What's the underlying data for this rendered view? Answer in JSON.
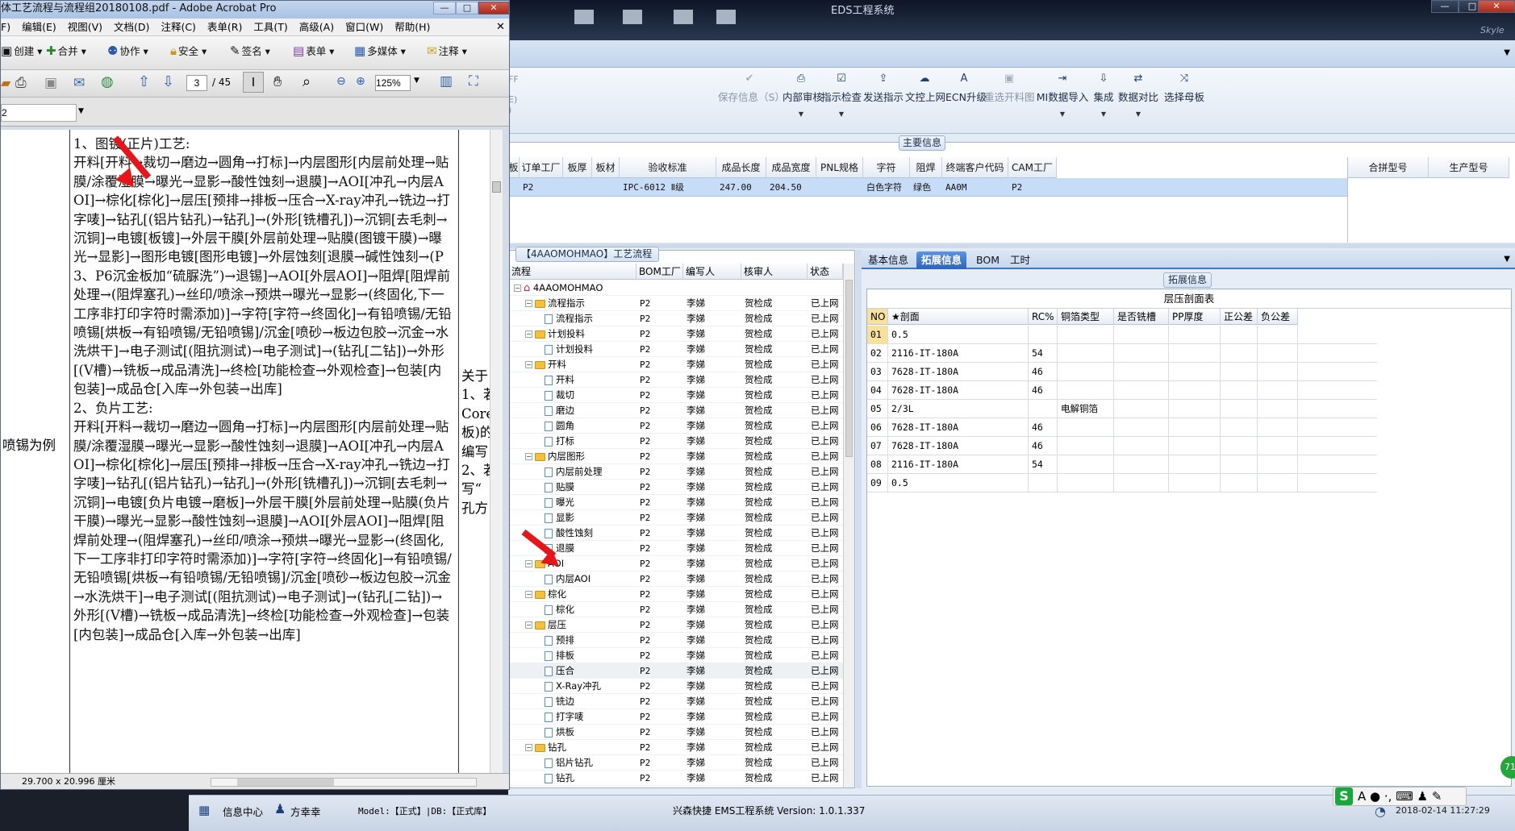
{
  "eds": {
    "title": "EDS工程系统",
    "skin": "Skyle",
    "window_buttons": [
      "—",
      "□",
      "✕"
    ],
    "toolbar": [
      {
        "label": "保存信息（S）",
        "icon": "checkmark-icon",
        "glyph": "✔",
        "disabled": true,
        "dropdown": false
      },
      {
        "label": "内部审核",
        "icon": "printer-icon",
        "glyph": "⎙",
        "disabled": false,
        "dropdown": true
      },
      {
        "label": "指示检查",
        "icon": "check-box-icon",
        "glyph": "☑",
        "disabled": false,
        "dropdown": true
      },
      {
        "label": "发送指示",
        "icon": "upload-icon",
        "glyph": "⇪",
        "disabled": false,
        "dropdown": false
      },
      {
        "label": "文控上网",
        "icon": "cloud-upload-icon",
        "glyph": "☁",
        "disabled": false,
        "dropdown": false
      },
      {
        "label": "ECN升级",
        "icon": "font-icon",
        "glyph": "A",
        "disabled": false,
        "dropdown": false
      },
      {
        "label": "重选开料图",
        "icon": "image-icon",
        "glyph": "▣",
        "disabled": true,
        "dropdown": false
      },
      {
        "label": "MI数据导入",
        "icon": "import-icon",
        "glyph": "⇥",
        "disabled": false,
        "dropdown": true
      },
      {
        "label": "集成",
        "icon": "download-icon",
        "glyph": "⇩",
        "disabled": false,
        "dropdown": true
      },
      {
        "label": "数据对比",
        "icon": "compare-icon",
        "glyph": "⇄",
        "disabled": false,
        "dropdown": true
      },
      {
        "label": "选择母板",
        "icon": "shuffle-icon",
        "glyph": "⤨",
        "disabled": false,
        "dropdown": false
      }
    ],
    "toolbar_left_stub": [
      "FF",
      "E)",
      ")"
    ],
    "main_info_title": "主要信息",
    "main_columns": [
      "板",
      "订单工厂",
      "板厚",
      "板材",
      "验收标准",
      "成品长度",
      "成品宽度",
      "PNL规格",
      "字符",
      "阻焊",
      "终端客户代码",
      "CAM工厂"
    ],
    "main_row": [
      "",
      "P2",
      "",
      "",
      "IPC-6012 Ⅱ级",
      "247.00",
      "204.50",
      "",
      "白色字符",
      "绿色",
      "AA0M",
      "P2"
    ],
    "right_columns": [
      "合拼型号",
      "生产型号"
    ],
    "flow_title": "【4AAOMOHMAO】工艺流程",
    "flow_columns": [
      "流程",
      "BOM工厂",
      "编写人",
      "核审人",
      "状态"
    ],
    "flow_root": "4AAOMOHMAO",
    "flow_rows": [
      {
        "name": "流程指示",
        "level": 1,
        "type": "folder",
        "bom": "P2",
        "writer": "李娣",
        "reviewer": "贺检成",
        "status": "已上网"
      },
      {
        "name": "流程指示",
        "level": 2,
        "type": "doc",
        "bom": "P2",
        "writer": "李娣",
        "reviewer": "贺检成",
        "status": "已上网"
      },
      {
        "name": "计划投料",
        "level": 1,
        "type": "folder",
        "bom": "P2",
        "writer": "李娣",
        "reviewer": "贺检成",
        "status": "已上网"
      },
      {
        "name": "计划投料",
        "level": 2,
        "type": "doc",
        "bom": "P2",
        "writer": "李娣",
        "reviewer": "贺检成",
        "status": "已上网"
      },
      {
        "name": "开料",
        "level": 1,
        "type": "folder",
        "bom": "P2",
        "writer": "李娣",
        "reviewer": "贺检成",
        "status": "已上网"
      },
      {
        "name": "开料",
        "level": 2,
        "type": "doc",
        "bom": "P2",
        "writer": "李娣",
        "reviewer": "贺检成",
        "status": "已上网"
      },
      {
        "name": "裁切",
        "level": 2,
        "type": "doc",
        "bom": "P2",
        "writer": "李娣",
        "reviewer": "贺检成",
        "status": "已上网"
      },
      {
        "name": "磨边",
        "level": 2,
        "type": "doc",
        "bom": "P2",
        "writer": "李娣",
        "reviewer": "贺检成",
        "status": "已上网"
      },
      {
        "name": "圆角",
        "level": 2,
        "type": "doc",
        "bom": "P2",
        "writer": "李娣",
        "reviewer": "贺检成",
        "status": "已上网"
      },
      {
        "name": "打标",
        "level": 2,
        "type": "doc",
        "bom": "P2",
        "writer": "李娣",
        "reviewer": "贺检成",
        "status": "已上网"
      },
      {
        "name": "内层图形",
        "level": 1,
        "type": "folder",
        "bom": "P2",
        "writer": "李娣",
        "reviewer": "贺检成",
        "status": "已上网"
      },
      {
        "name": "内层前处理",
        "level": 2,
        "type": "doc",
        "bom": "P2",
        "writer": "李娣",
        "reviewer": "贺检成",
        "status": "已上网"
      },
      {
        "name": "贴膜",
        "level": 2,
        "type": "doc",
        "bom": "P2",
        "writer": "李娣",
        "reviewer": "贺检成",
        "status": "已上网"
      },
      {
        "name": "曝光",
        "level": 2,
        "type": "doc",
        "bom": "P2",
        "writer": "李娣",
        "reviewer": "贺检成",
        "status": "已上网"
      },
      {
        "name": "显影",
        "level": 2,
        "type": "doc",
        "bom": "P2",
        "writer": "李娣",
        "reviewer": "贺检成",
        "status": "已上网"
      },
      {
        "name": "酸性蚀刻",
        "level": 2,
        "type": "doc",
        "bom": "P2",
        "writer": "李娣",
        "reviewer": "贺检成",
        "status": "已上网"
      },
      {
        "name": "退膜",
        "level": 2,
        "type": "doc",
        "bom": "P2",
        "writer": "李娣",
        "reviewer": "贺检成",
        "status": "已上网"
      },
      {
        "name": "AOI",
        "level": 1,
        "type": "folder",
        "bom": "P2",
        "writer": "李娣",
        "reviewer": "贺检成",
        "status": "已上网"
      },
      {
        "name": "内层AOI",
        "level": 2,
        "type": "doc",
        "bom": "P2",
        "writer": "李娣",
        "reviewer": "贺检成",
        "status": "已上网"
      },
      {
        "name": "棕化",
        "level": 1,
        "type": "folder",
        "bom": "P2",
        "writer": "李娣",
        "reviewer": "贺检成",
        "status": "已上网"
      },
      {
        "name": "棕化",
        "level": 2,
        "type": "doc",
        "bom": "P2",
        "writer": "李娣",
        "reviewer": "贺检成",
        "status": "已上网"
      },
      {
        "name": "层压",
        "level": 1,
        "type": "folder",
        "bom": "P2",
        "writer": "李娣",
        "reviewer": "贺检成",
        "status": "已上网"
      },
      {
        "name": "预排",
        "level": 2,
        "type": "doc",
        "bom": "P2",
        "writer": "李娣",
        "reviewer": "贺检成",
        "status": "已上网"
      },
      {
        "name": "排板",
        "level": 2,
        "type": "doc",
        "bom": "P2",
        "writer": "李娣",
        "reviewer": "贺检成",
        "status": "已上网"
      },
      {
        "name": "压合",
        "level": 2,
        "type": "doc",
        "bom": "P2",
        "writer": "李娣",
        "reviewer": "贺检成",
        "status": "已上网",
        "selected": true
      },
      {
        "name": "X-Ray冲孔",
        "level": 2,
        "type": "doc",
        "bom": "P2",
        "writer": "李娣",
        "reviewer": "贺检成",
        "status": "已上网"
      },
      {
        "name": "铣边",
        "level": 2,
        "type": "doc",
        "bom": "P2",
        "writer": "李娣",
        "reviewer": "贺检成",
        "status": "已上网"
      },
      {
        "name": "打字唛",
        "level": 2,
        "type": "doc",
        "bom": "P2",
        "writer": "李娣",
        "reviewer": "贺检成",
        "status": "已上网"
      },
      {
        "name": "烘板",
        "level": 2,
        "type": "doc",
        "bom": "P2",
        "writer": "李娣",
        "reviewer": "贺检成",
        "status": "已上网"
      },
      {
        "name": "钻孔",
        "level": 1,
        "type": "folder",
        "bom": "P2",
        "writer": "李娣",
        "reviewer": "贺检成",
        "status": "已上网"
      },
      {
        "name": "铝片钻孔",
        "level": 2,
        "type": "doc",
        "bom": "P2",
        "writer": "李娣",
        "reviewer": "贺检成",
        "status": "已上网"
      },
      {
        "name": "钻孔",
        "level": 2,
        "type": "doc",
        "bom": "P2",
        "writer": "李娣",
        "reviewer": "贺检成",
        "status": "已上网"
      }
    ],
    "detail_tabs": [
      "基本信息",
      "拓展信息",
      "BOM",
      "工时"
    ],
    "detail_active_tab": 1,
    "ext_title": "拓展信息",
    "stack_title": "层压剖面表",
    "stack_columns": [
      "NO",
      "★剖面",
      "RC%",
      "铜箔类型",
      "是否铣槽",
      "PP厚度",
      "正公差",
      "负公差"
    ],
    "stack_rows": [
      [
        "01",
        "0.5",
        "",
        "",
        "",
        "",
        "",
        ""
      ],
      [
        "02",
        "2116-IT-180A",
        "54",
        "",
        "",
        "",
        "",
        ""
      ],
      [
        "03",
        "7628-IT-180A",
        "46",
        "",
        "",
        "",
        "",
        ""
      ],
      [
        "04",
        "7628-IT-180A",
        "46",
        "",
        "",
        "",
        "",
        ""
      ],
      [
        "05",
        "2/3L",
        "",
        "电解铜箔",
        "",
        "",
        "",
        ""
      ],
      [
        "06",
        "7628-IT-180A",
        "46",
        "",
        "",
        "",
        "",
        ""
      ],
      [
        "07",
        "7628-IT-180A",
        "46",
        "",
        "",
        "",
        "",
        ""
      ],
      [
        "08",
        "2116-IT-180A",
        "54",
        "",
        "",
        "",
        "",
        ""
      ],
      [
        "09",
        "0.5",
        "",
        "",
        "",
        "",
        "",
        ""
      ]
    ]
  },
  "statusbar": {
    "info_center": "信息中心",
    "user": "方幸幸",
    "model": "Model:【正式】|DB:【正式库】",
    "system": "兴森快捷  EMS工程系统  Version: 1.0.1.337",
    "datetime": "2018-02-14  11:27:29",
    "tray_badge": "71",
    "ime": "S"
  },
  "acrobat": {
    "title": "体工艺流程与流程组20180108.pdf - Adobe Acrobat Pro",
    "menus": [
      "F)",
      "编辑(E)",
      "视图(V)",
      "文档(D)",
      "注释(C)",
      "表单(R)",
      "工具(T)",
      "高级(A)",
      "窗口(W)",
      "帮助(H)"
    ],
    "toolbar1": [
      "创建",
      "合并",
      "协作",
      "安全",
      "签名",
      "表单",
      "多媒体",
      "注释"
    ],
    "page_current": "3",
    "page_total": "/ 45",
    "zoom": "125%",
    "nav_value": "2",
    "page_size": "29.700 x 20.996 厘米",
    "left_cell_text": "喷锡为例",
    "right_cell_text": "关于\n1、若\nCore\n板)的\n编写\n2、若\n写“\n孔方",
    "body_text": "1、图镀(正片)工艺:\n开料[开料→裁切→磨边→圆角→打标]→内层图形[内层前处理→贴膜/涂覆湿膜→曝光→显影→酸性蚀刻→退膜]→AOI[冲孔→内层AOI]→棕化[棕化]→层压[预排→排板→压合→X-ray冲孔→铣边→打字唛]→钻孔[(铝片钻孔)→钻孔]→(外形[铣槽孔])→沉铜[去毛刺→沉铜]→电镀[板镀]→外层干膜[外层前处理→贴膜(图镀干膜)→曝光→显影]→图形电镀[图形电镀]→外层蚀刻[退膜→碱性蚀刻→(P3、P6沉金板加“硫脲洗”)→退锡]→AOI[外层AOI]→阻焊[阻焊前处理→(阻焊塞孔)→丝印/喷涂→预烘→曝光→显影→(终固化,下一工序非打印字符时需添加)]→字符[字符→终固化]→有铅喷锡/无铅喷锡[烘板→有铅喷锡/无铅喷锡]/沉金[喷砂→板边包胶→沉金→水洗烘干]→电子测试[(阻抗测试)→电子测试]→(钻孔[二钻])→外形[(V槽)→铣板→成品清洗]→终检[功能检查→外观检查]→包装[内包装]→成品仓[入库→外包装→出库]\n2、负片工艺:\n开料[开料→裁切→磨边→圆角→打标]→内层图形[内层前处理→贴膜/涂覆湿膜→曝光→显影→酸性蚀刻→退膜]→AOI[冲孔→内层AOI]→棕化[棕化]→层压[预排→排板→压合→X-ray冲孔→铣边→打字唛]→钻孔[(铝片钻孔)→钻孔]→(外形[铣槽孔])→沉铜[去毛刺→沉铜]→电镀[负片电镀→磨板]→外层干膜[外层前处理→贴膜(负片干膜)→曝光→显影→酸性蚀刻→退膜]→AOI[外层AOI]→阻焊[阻焊前处理→(阻焊塞孔)→丝印/喷涂→预烘→曝光→显影→(终固化,下一工序非打印字符时需添加)]→字符[字符→终固化]→有铅喷锡/无铅喷锡[烘板→有铅喷锡/无铅喷锡]/沉金[喷砂→板边包胶→沉金→水洗烘干]→电子测试[(阻抗测试)→电子测试]→(钻孔[二钻])→外形[(V槽)→铣板→成品清洗]→终检[功能检查→外观检查]→包装[内包装]→成品仓[入库→外包装→出库]"
  }
}
